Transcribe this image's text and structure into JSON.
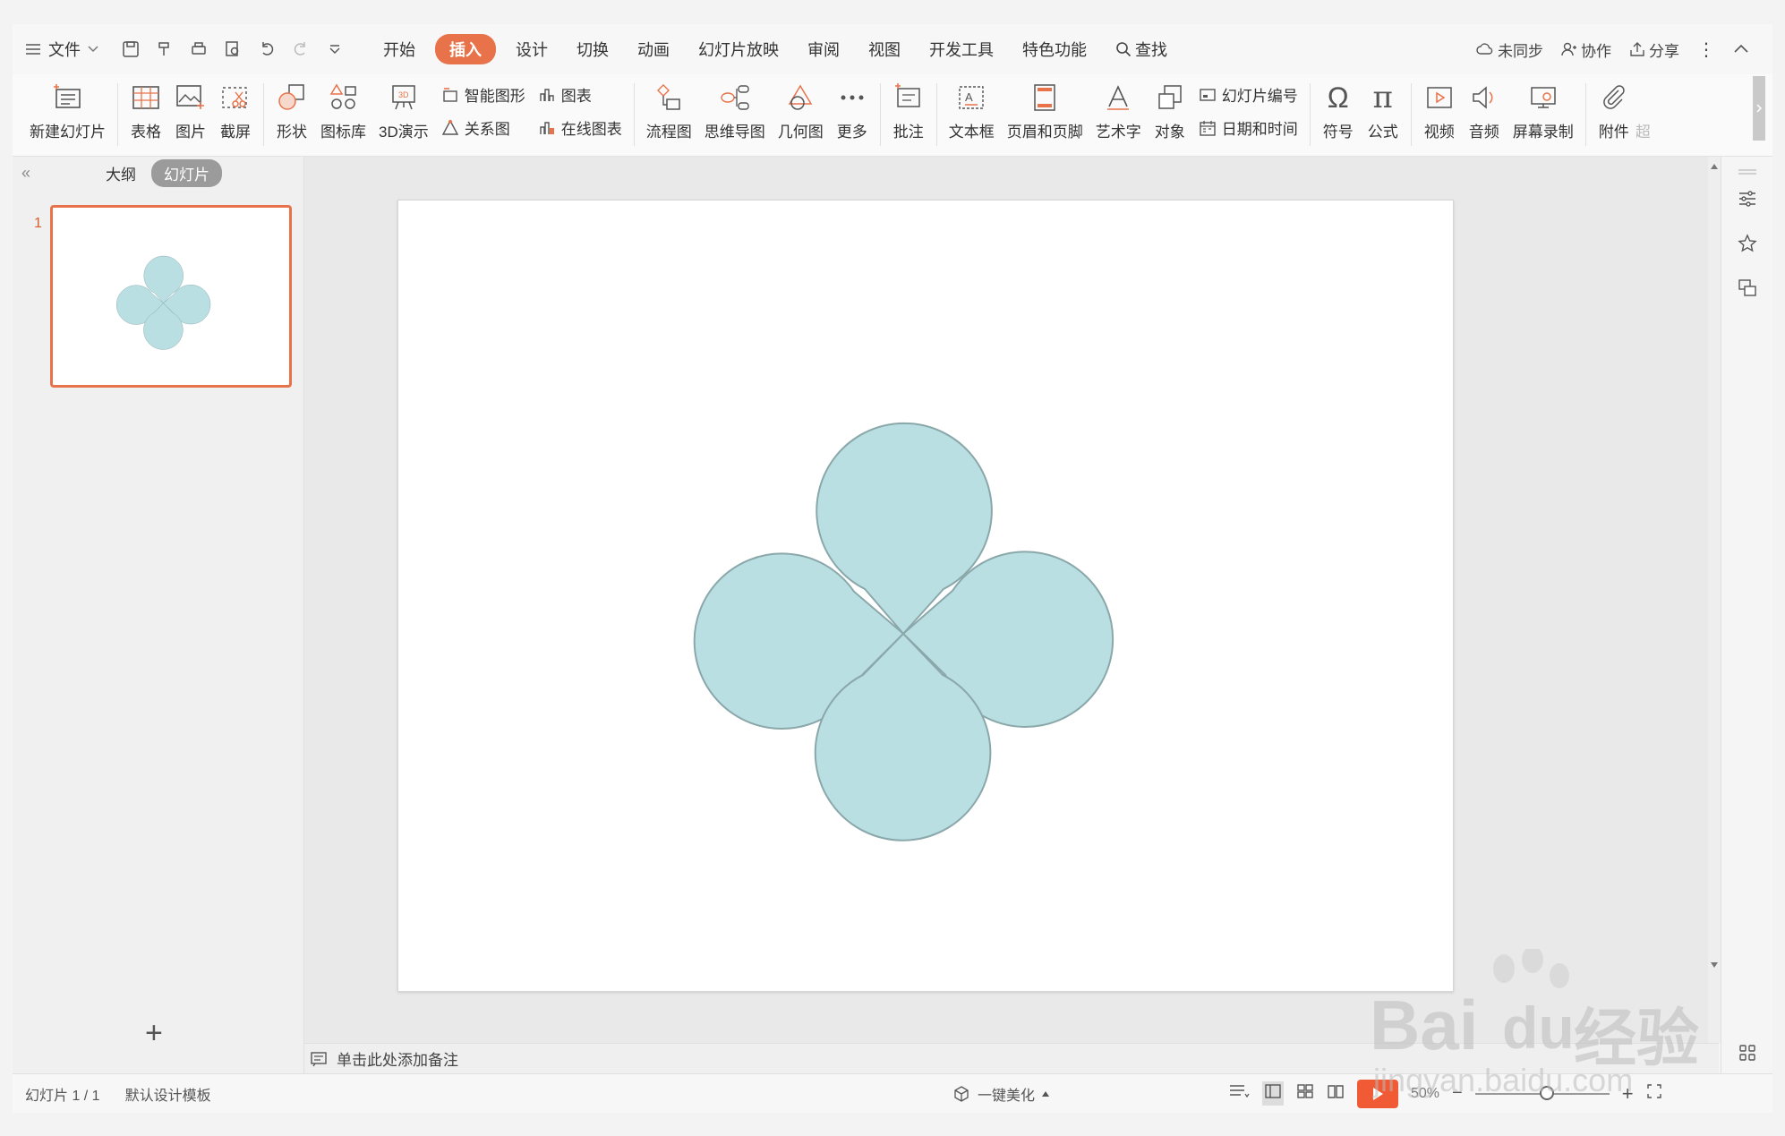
{
  "menubar": {
    "file_label": "文件",
    "tabs": [
      "开始",
      "插入",
      "设计",
      "切换",
      "动画",
      "幻灯片放映",
      "审阅",
      "视图",
      "开发工具",
      "特色功能"
    ],
    "active_tab": "插入",
    "search_label": "查找",
    "sync_label": "未同步",
    "collab_label": "协作",
    "share_label": "分享"
  },
  "ribbon": {
    "new_slide": "新建幻灯片",
    "table": "表格",
    "picture": "图片",
    "screenshot": "截屏",
    "shape": "形状",
    "icon_lib": "图标库",
    "demo3d": "3D演示",
    "smart_shape": "智能图形",
    "chart": "图表",
    "relation": "关系图",
    "online_chart": "在线图表",
    "flowchart": "流程图",
    "mindmap": "思维导图",
    "geometry": "几何图",
    "more": "更多",
    "comment": "批注",
    "textbox": "文本框",
    "header_footer": "页眉和页脚",
    "wordart": "艺术字",
    "object": "对象",
    "slide_number": "幻灯片编号",
    "datetime": "日期和时间",
    "symbol": "符号",
    "formula": "公式",
    "video": "视频",
    "audio": "音频",
    "screen_record": "屏幕录制",
    "attachment": "附件",
    "overflow": "超"
  },
  "left_panel": {
    "outline_tab": "大纲",
    "slides_tab": "幻灯片",
    "slide_number": "1"
  },
  "notes": {
    "placeholder": "单击此处添加备注"
  },
  "statusbar": {
    "slide_info": "幻灯片 1 / 1",
    "template": "默认设计模板",
    "beautify": "一键美化",
    "zoom": "50%"
  },
  "watermark": {
    "brand": "Bai",
    "brand2": "du",
    "cn": "经验",
    "url": "jingyan.baidu.com"
  },
  "colors": {
    "accent": "#e8734a",
    "petal_fill": "#b9dfe2",
    "petal_stroke": "#8aa7aa",
    "play": "#f05a34"
  }
}
